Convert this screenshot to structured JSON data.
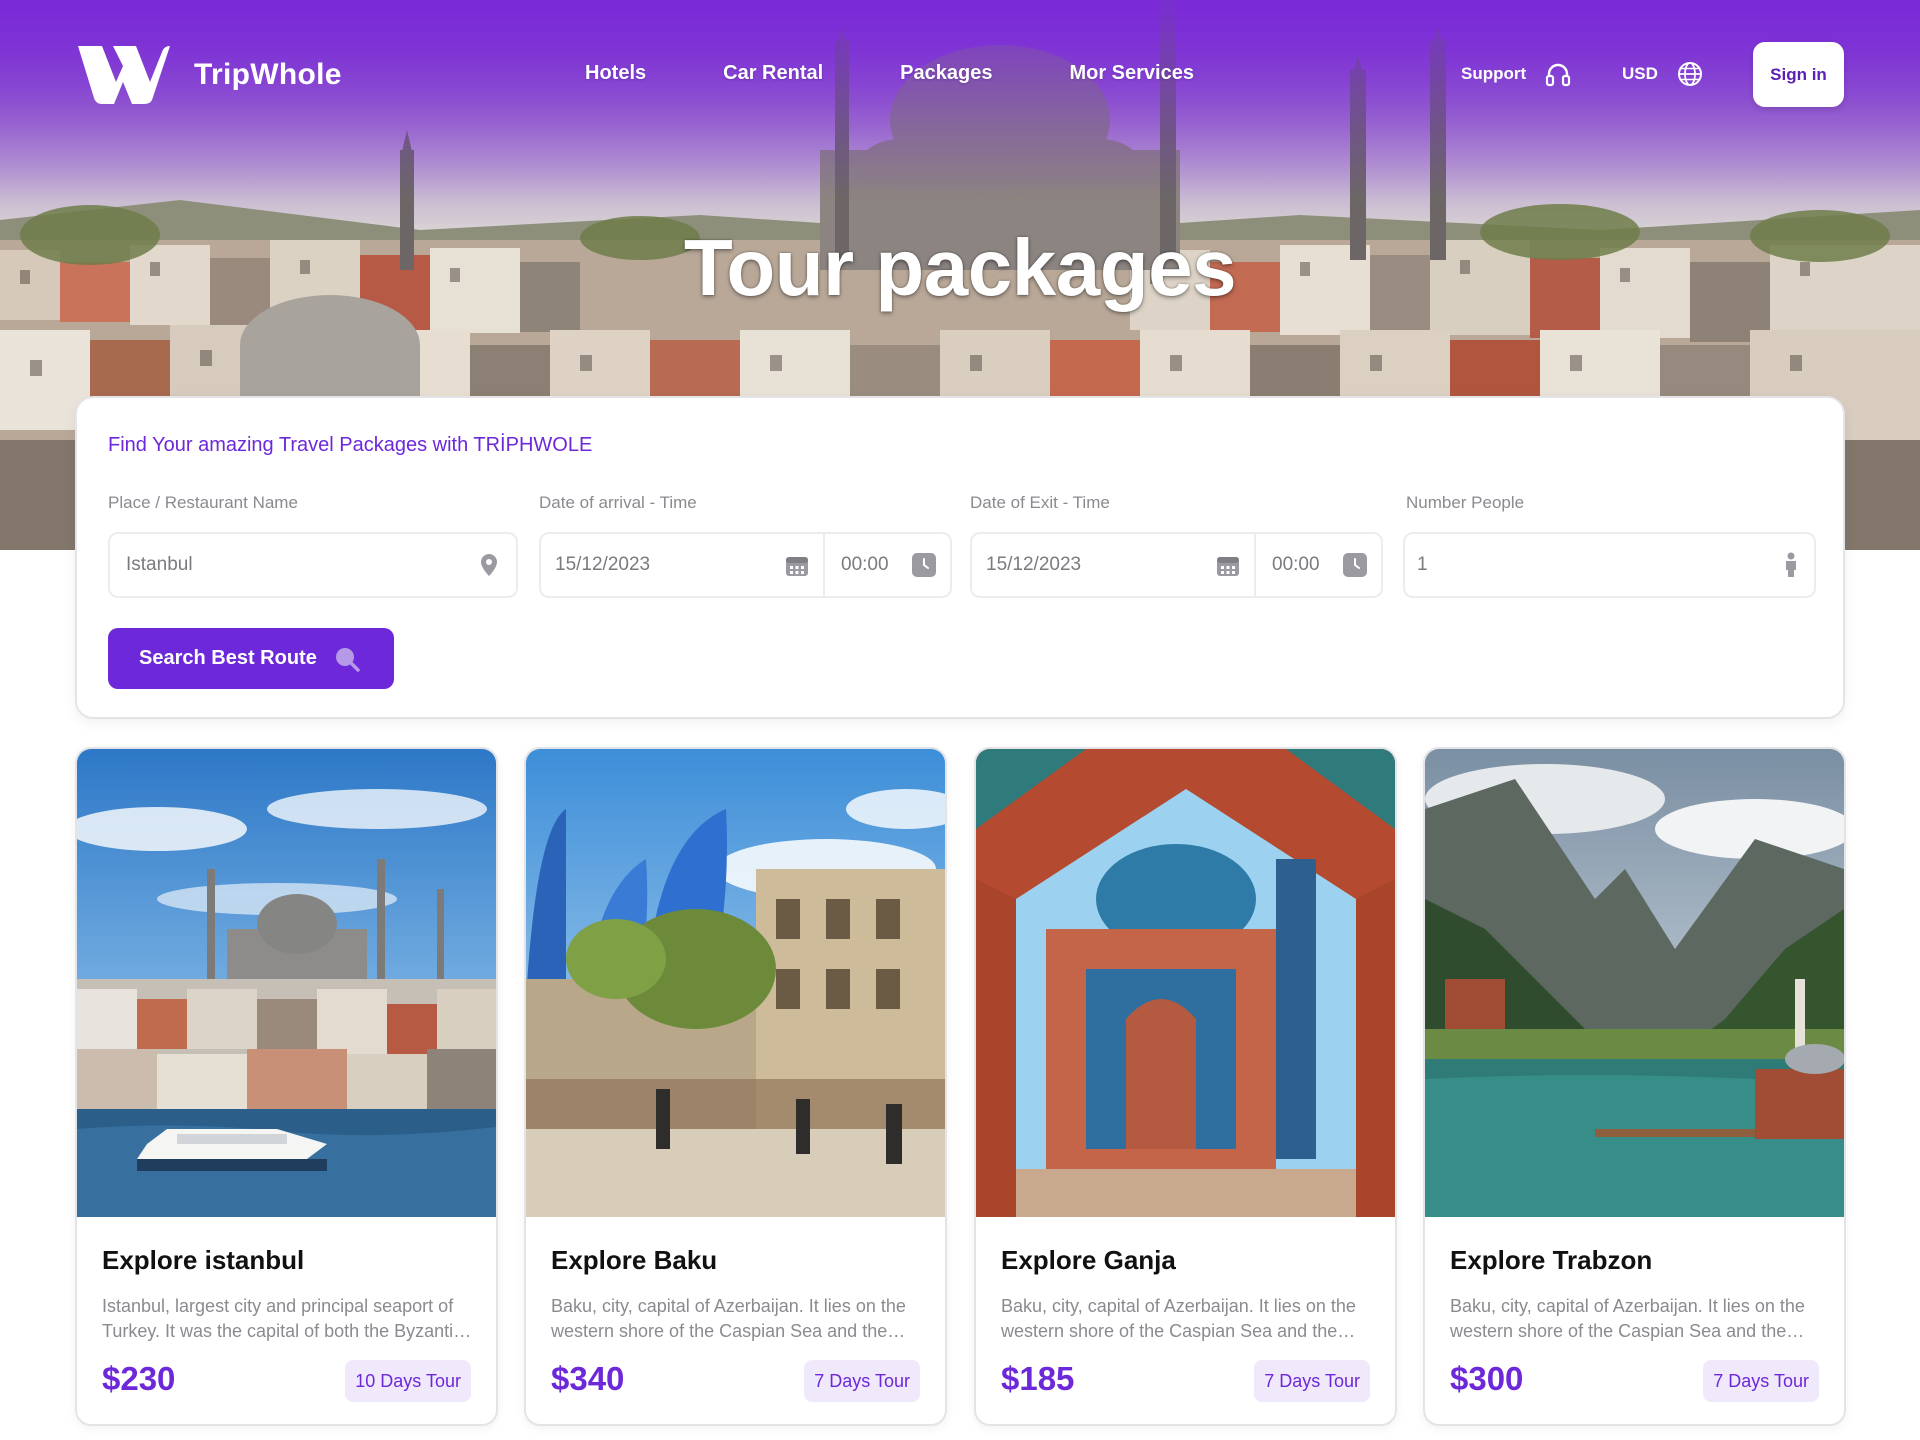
{
  "brand": {
    "name": "TripWhole",
    "accent": "#6d28d9"
  },
  "nav": {
    "items": [
      "Hotels",
      "Car Rental",
      "Packages",
      "Mor Services"
    ]
  },
  "utility": {
    "support_label": "Support",
    "currency_label": "USD",
    "signin_label": "Sign in"
  },
  "hero": {
    "title": "Tour packages"
  },
  "search": {
    "title": "Find Your amazing Travel Packages with TRİPHWOLE",
    "place": {
      "label": "Place / Restaurant Name",
      "value": "Istanbul"
    },
    "arrival": {
      "label": "Date of arrival - Time",
      "date": "15/12/2023",
      "time": "00:00"
    },
    "exit": {
      "label": "Date of Exit - Time",
      "date": "15/12/2023",
      "time": "00:00"
    },
    "people": {
      "label": "Number People",
      "value": "1"
    },
    "button_label": "Search Best Route"
  },
  "packages": [
    {
      "title": "Explore istanbul",
      "description": "Istanbul, largest city and principal seaport of Turkey. It was the capital of both the Byzantine and Ottoman empires.",
      "price": "$230",
      "duration": "10 Days Tour"
    },
    {
      "title": "Explore Baku",
      "description": "Baku, city, capital of Azerbaijan. It lies on the western shore of the Caspian Sea and the southern side of the Abşeron Peninsula.",
      "price": "$340",
      "duration": "7 Days Tour"
    },
    {
      "title": "Explore Ganja",
      "description": "Baku, city, capital of Azerbaijan. It lies on the western shore of the Caspian Sea and the southern side of the Abşeron Peninsula.",
      "price": "$185",
      "duration": "7 Days Tour"
    },
    {
      "title": "Explore Trabzon",
      "description": "Baku, city, capital of Azerbaijan. It lies on the western shore of the Caspian Sea and the southern side of the Abşeron Peninsula.",
      "price": "$300",
      "duration": "7 Days Tour"
    }
  ]
}
